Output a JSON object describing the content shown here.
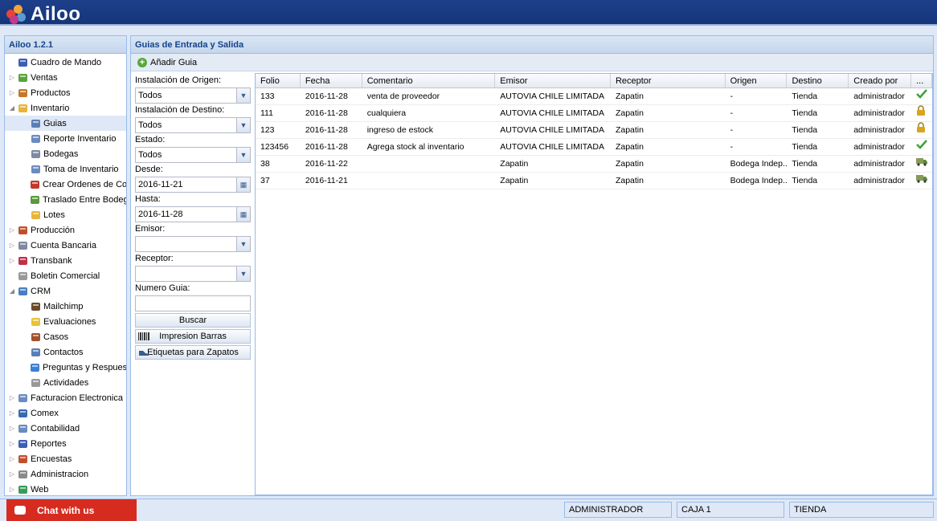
{
  "app": {
    "name": "Ailoo",
    "version_label": "Ailoo 1.2.1"
  },
  "nav": [
    {
      "label": "Cuadro de Mando",
      "level": 0,
      "expander": "",
      "icon": "bar-chart-icon",
      "color": "#3b5fb5"
    },
    {
      "label": "Ventas",
      "level": 0,
      "expander": "▷",
      "icon": "tag-icon",
      "color": "#5aa33b"
    },
    {
      "label": "Productos",
      "level": 0,
      "expander": "▷",
      "icon": "box-icon",
      "color": "#c7752a"
    },
    {
      "label": "Inventario",
      "level": 0,
      "expander": "◢",
      "icon": "cube-icon",
      "color": "#e8b43a"
    },
    {
      "label": "Guias",
      "level": 1,
      "expander": "",
      "icon": "document-icon",
      "color": "#5a7fb5",
      "selected": true
    },
    {
      "label": "Reporte Inventario",
      "level": 1,
      "expander": "",
      "icon": "report-icon",
      "color": "#6b8cc0"
    },
    {
      "label": "Bodegas",
      "level": 1,
      "expander": "",
      "icon": "warehouse-icon",
      "color": "#7d8aa0"
    },
    {
      "label": "Toma de Inventario",
      "level": 1,
      "expander": "",
      "icon": "clipboard-icon",
      "color": "#6b8cc0"
    },
    {
      "label": "Crear Ordenes de Compra",
      "level": 1,
      "expander": "",
      "icon": "cart-icon",
      "color": "#c03a2b"
    },
    {
      "label": "Traslado Entre Bodegas",
      "level": 1,
      "expander": "",
      "icon": "truck-icon",
      "color": "#5a9a3a"
    },
    {
      "label": "Lotes",
      "level": 1,
      "expander": "",
      "icon": "package-icon",
      "color": "#e8b43a"
    },
    {
      "label": "Producción",
      "level": 0,
      "expander": "▷",
      "icon": "factory-icon",
      "color": "#c0502b"
    },
    {
      "label": "Cuenta Bancaria",
      "level": 0,
      "expander": "▷",
      "icon": "bank-icon",
      "color": "#7d8aa0"
    },
    {
      "label": "Transbank",
      "level": 0,
      "expander": "▷",
      "icon": "transbank-icon",
      "color": "#c0304a"
    },
    {
      "label": "Boletin Comercial",
      "level": 0,
      "expander": "",
      "icon": "tag-gray-icon",
      "color": "#999999"
    },
    {
      "label": "CRM",
      "level": 0,
      "expander": "◢",
      "icon": "people-icon",
      "color": "#4a7ec0"
    },
    {
      "label": "Mailchimp",
      "level": 1,
      "expander": "",
      "icon": "mailchimp-icon",
      "color": "#6b4a2a"
    },
    {
      "label": "Evaluaciones",
      "level": 1,
      "expander": "",
      "icon": "folder-icon",
      "color": "#e8c23a"
    },
    {
      "label": "Casos",
      "level": 1,
      "expander": "",
      "icon": "briefcase-icon",
      "color": "#a0522d"
    },
    {
      "label": "Contactos",
      "level": 1,
      "expander": "",
      "icon": "contact-card-icon",
      "color": "#5a7fb5"
    },
    {
      "label": "Preguntas y Respuestas",
      "level": 1,
      "expander": "",
      "icon": "help-icon",
      "color": "#3a7fd5"
    },
    {
      "label": "Actividades",
      "level": 1,
      "expander": "",
      "icon": "tag-gray-icon",
      "color": "#999999"
    },
    {
      "label": "Facturacion Electronica",
      "level": 0,
      "expander": "▷",
      "icon": "invoice-icon",
      "color": "#6b8cc0"
    },
    {
      "label": "Comex",
      "level": 0,
      "expander": "▷",
      "icon": "ship-icon",
      "color": "#3a6ab0"
    },
    {
      "label": "Contabilidad",
      "level": 0,
      "expander": "▷",
      "icon": "ledger-icon",
      "color": "#6b8cc0"
    },
    {
      "label": "Reportes",
      "level": 0,
      "expander": "▷",
      "icon": "bar-chart-icon",
      "color": "#3b5fb5"
    },
    {
      "label": "Encuestas",
      "level": 0,
      "expander": "▷",
      "icon": "survey-icon",
      "color": "#c0502b"
    },
    {
      "label": "Administracion",
      "level": 0,
      "expander": "▷",
      "icon": "gear-icon",
      "color": "#8a8a8a"
    },
    {
      "label": "Web",
      "level": 0,
      "expander": "▷",
      "icon": "globe-icon",
      "color": "#3a9a5a"
    }
  ],
  "main": {
    "title": "Guias de Entrada y Salida",
    "add_label": "Añadir Guia",
    "filters": {
      "origen_label": "Instalación de Origen:",
      "origen_value": "Todos",
      "destino_label": "Instalación de Destino:",
      "destino_value": "Todos",
      "estado_label": "Estado:",
      "estado_value": "Todos",
      "desde_label": "Desde:",
      "desde_value": "2016-11-21",
      "hasta_label": "Hasta:",
      "hasta_value": "2016-11-28",
      "emisor_label": "Emisor:",
      "emisor_value": "",
      "receptor_label": "Receptor:",
      "receptor_value": "",
      "numero_label": "Numero Guia:",
      "numero_value": "",
      "buscar_label": "Buscar",
      "impresion_label": "Impresion Barras",
      "etiquetas_label": "Etiquetas para Zapatos"
    },
    "columns": [
      "Folio",
      "Fecha",
      "Comentario",
      "Emisor",
      "Receptor",
      "Origen",
      "Destino",
      "Creado por",
      "..."
    ],
    "rows": [
      {
        "folio": "133",
        "fecha": "2016-11-28",
        "comentario": "venta de proveedor",
        "emisor": "AUTOVIA CHILE LIMITADA",
        "receptor": "Zapatin",
        "origen": "-",
        "destino": "Tienda",
        "creado": "administrador",
        "status": "check"
      },
      {
        "folio": "111",
        "fecha": "2016-11-28",
        "comentario": "cualquiera",
        "emisor": "AUTOVIA CHILE LIMITADA",
        "receptor": "Zapatin",
        "origen": "-",
        "destino": "Tienda",
        "creado": "administrador",
        "status": "lock"
      },
      {
        "folio": "123",
        "fecha": "2016-11-28",
        "comentario": "ingreso de estock",
        "emisor": "AUTOVIA CHILE LIMITADA",
        "receptor": "Zapatin",
        "origen": "-",
        "destino": "Tienda",
        "creado": "administrador",
        "status": "lock"
      },
      {
        "folio": "123456",
        "fecha": "2016-11-28",
        "comentario": "Agrega stock al inventario",
        "emisor": "AUTOVIA CHILE LIMITADA",
        "receptor": "Zapatin",
        "origen": "-",
        "destino": "Tienda",
        "creado": "administrador",
        "status": "check"
      },
      {
        "folio": "38",
        "fecha": "2016-11-22",
        "comentario": "",
        "emisor": "Zapatin",
        "receptor": "Zapatin",
        "origen": "Bodega Indep...",
        "destino": "Tienda",
        "creado": "administrador",
        "status": "truck"
      },
      {
        "folio": "37",
        "fecha": "2016-11-21",
        "comentario": "",
        "emisor": "Zapatin",
        "receptor": "Zapatin",
        "origen": "Bodega Indep...",
        "destino": "Tienda",
        "creado": "administrador",
        "status": "truck"
      }
    ]
  },
  "status": {
    "chat_label": "Chat with us",
    "user": "ADMINISTRADOR",
    "caja": "CAJA 1",
    "tienda": "TIENDA"
  },
  "colors": {
    "header": "#16367a",
    "panel_border": "#99bbe8",
    "chat": "#d62b1f",
    "check": "#3aa33a",
    "lock": "#d9a520"
  }
}
